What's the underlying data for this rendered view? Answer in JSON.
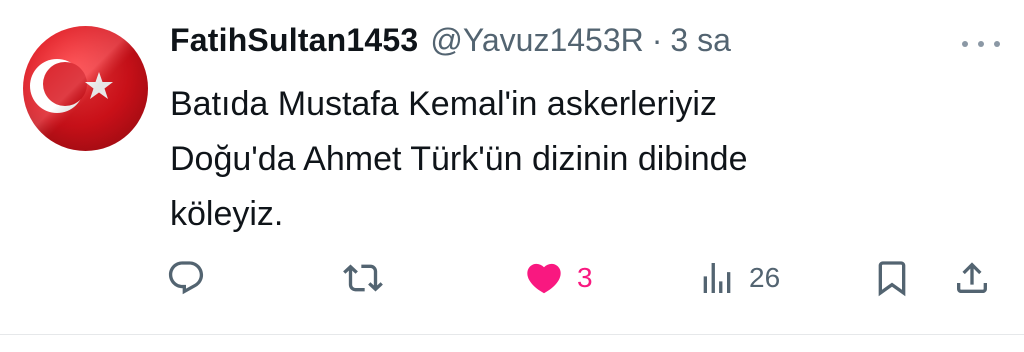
{
  "tweet": {
    "display_name": "FatihSultan1453",
    "handle": "@Yavuz1453R",
    "separator": "·",
    "time": "3 sa",
    "text_lines": [
      "Batıda Mustafa Kemal'in askerleriyiz",
      "Doğu'da Ahmet Türk'ün dizinin dibinde",
      "köleyiz."
    ],
    "avatar": {
      "description_icon": "turkish-flag-icon",
      "colors": {
        "red": "#d8111a",
        "white": "#ffffff"
      }
    }
  },
  "actions": {
    "reply": {
      "icon": "reply-icon"
    },
    "retweet": {
      "icon": "retweet-icon"
    },
    "like": {
      "icon": "heart-icon",
      "count": "3",
      "active": true
    },
    "views": {
      "icon": "views-icon",
      "count": "26"
    },
    "bookmark": {
      "icon": "bookmark-icon"
    },
    "share": {
      "icon": "share-icon"
    }
  },
  "colors": {
    "text": "#0f1419",
    "secondary": "#536471",
    "like": "#f91880",
    "icon": "#536471"
  }
}
